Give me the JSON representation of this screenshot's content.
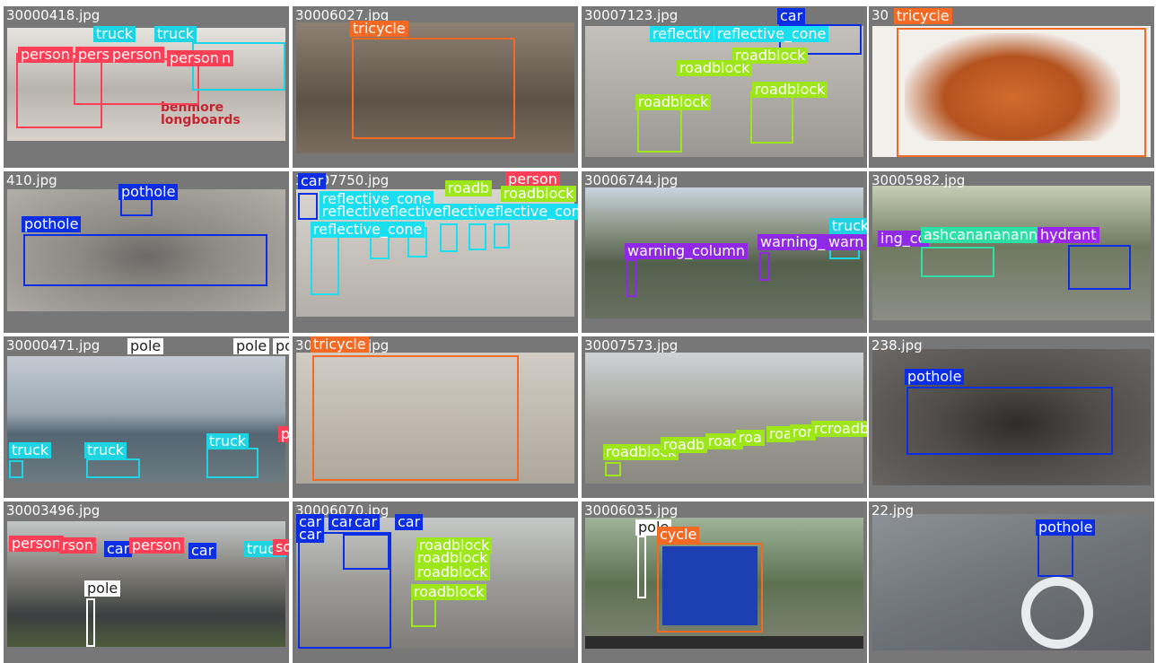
{
  "colors": {
    "person": "#ff3f55",
    "truck": "#1fd4e2",
    "tricycle": "#f46a25",
    "reflective_cone": "#19dff0",
    "roadblock": "#9ce619",
    "car": "#0b2de3",
    "pothole": "#0b2de3",
    "warning_column": "#8f29e6",
    "pole": "#ffffff",
    "hydrant": "#9b25e8",
    "trash_can": "#2ee0a6"
  },
  "tiles": [
    {
      "filename": "30000418.jpg",
      "photo_color": "#cfc8c0",
      "labels": [
        {
          "text": "truck",
          "cls": "truck"
        },
        {
          "text": "truck",
          "cls": "truck"
        },
        {
          "text": "person",
          "cls": "person"
        },
        {
          "text": "pers",
          "cls": "person"
        },
        {
          "text": "person",
          "cls": "person"
        },
        {
          "text": "person",
          "cls": "person"
        },
        {
          "text": "n",
          "cls": "person"
        },
        {
          "text": "benmore longboards",
          "cls": "logo"
        }
      ]
    },
    {
      "filename": "30006027.jpg",
      "photo_color": "#6b5d4e",
      "labels": [
        {
          "text": "tricycle",
          "cls": "tricycle"
        }
      ]
    },
    {
      "filename": "30007123.jpg",
      "photo_color": "#a3a09a",
      "labels": [
        {
          "text": "car",
          "cls": "car"
        },
        {
          "text": "reflective_cone",
          "cls": "reflective_cone"
        },
        {
          "text": "reflectiv",
          "cls": "reflective_cone"
        },
        {
          "text": "roadblock",
          "cls": "roadblock"
        },
        {
          "text": "roadblock",
          "cls": "roadblock"
        },
        {
          "text": "roadblock",
          "cls": "roadblock"
        },
        {
          "text": "roadblock",
          "cls": "roadblock"
        }
      ]
    },
    {
      "filename": "30007251.jpg",
      "filename_visible": "30",
      "photo_color": "#f2efec",
      "labels": [
        {
          "text": "tricycle",
          "cls": "tricycle"
        }
      ]
    },
    {
      "filename": "410.jpg",
      "photo_color": "#8f8c87",
      "labels": [
        {
          "text": "pothole",
          "cls": "pothole"
        },
        {
          "text": "pothole",
          "cls": "pothole"
        }
      ]
    },
    {
      "filename": "30007750.jpg",
      "photo_color": "#b9b5b0",
      "labels": [
        {
          "text": "car",
          "cls": "car"
        },
        {
          "text": "person",
          "cls": "person"
        },
        {
          "text": "reflective_cone",
          "cls": "reflective_cone"
        },
        {
          "text": "reflectiveflectiveflectiveflective_cone",
          "cls": "reflective_cone"
        },
        {
          "text": "reflective_cone",
          "cls": "reflective_cone"
        },
        {
          "text": "roadblock",
          "cls": "roadblock"
        },
        {
          "text": "roadb",
          "cls": "roadblock"
        },
        {
          "text": "ck",
          "cls": "roadblock"
        }
      ]
    },
    {
      "filename": "30006744.jpg",
      "photo_color": "#5f6a5a",
      "labels": [
        {
          "text": "warning_column",
          "cls": "warning_column"
        },
        {
          "text": "warning_",
          "cls": "warning_column"
        },
        {
          "text": "warn",
          "cls": "warning_column"
        },
        {
          "text": "truck",
          "cls": "truck"
        }
      ]
    },
    {
      "filename": "30005982.jpg",
      "photo_color": "#6f7a64",
      "labels": [
        {
          "text": "ing_co",
          "cls": "warning_column"
        },
        {
          "text": "ashcanananann",
          "cls": "trash_can"
        },
        {
          "text": "hydrant",
          "cls": "hydrant"
        }
      ]
    },
    {
      "filename": "30000471.jpg",
      "photo_color": "#8ea0ad",
      "labels": [
        {
          "text": "pole",
          "cls": "pole"
        },
        {
          "text": "pole",
          "cls": "pole"
        },
        {
          "text": "pole",
          "cls": "pole"
        },
        {
          "text": "truck",
          "cls": "truck"
        },
        {
          "text": "truck",
          "cls": "truck"
        },
        {
          "text": "truck",
          "cls": "truck"
        },
        {
          "text": "person",
          "cls": "person"
        }
      ]
    },
    {
      "filename": "30000381.jpg",
      "photo_color": "#bdb7ae",
      "labels": [
        {
          "text": "tricycle",
          "cls": "tricycle"
        }
      ]
    },
    {
      "filename": "30007573.jpg",
      "photo_color": "#9a9990",
      "labels": [
        {
          "text": "roadblock",
          "cls": "roadblock"
        },
        {
          "text": "roadb",
          "cls": "roadblock"
        },
        {
          "text": "road",
          "cls": "roadblock"
        },
        {
          "text": "roa",
          "cls": "roadblock"
        },
        {
          "text": "roa",
          "cls": "roadblock"
        },
        {
          "text": "ror",
          "cls": "roadblock"
        },
        {
          "text": "rcroadblock",
          "cls": "roadblock"
        }
      ]
    },
    {
      "filename": "238.jpg",
      "photo_color": "#4e4c4a",
      "labels": [
        {
          "text": "pothole",
          "cls": "pothole"
        }
      ]
    },
    {
      "filename": "30003496.jpg",
      "photo_color": "#8c8a86",
      "labels": [
        {
          "text": "person",
          "cls": "person"
        },
        {
          "text": "rson",
          "cls": "person"
        },
        {
          "text": "car",
          "cls": "car"
        },
        {
          "text": "person",
          "cls": "person"
        },
        {
          "text": "car",
          "cls": "car"
        },
        {
          "text": "truck",
          "cls": "truck"
        },
        {
          "text": "son",
          "cls": "person"
        },
        {
          "text": "pole",
          "cls": "pole"
        }
      ]
    },
    {
      "filename": "30006070.jpg",
      "photo_color": "#9d9b98",
      "labels": [
        {
          "text": "car",
          "cls": "car"
        },
        {
          "text": "car",
          "cls": "car"
        },
        {
          "text": "car",
          "cls": "car"
        },
        {
          "text": "car",
          "cls": "car"
        },
        {
          "text": "car",
          "cls": "car"
        },
        {
          "text": "roadblock",
          "cls": "roadblock"
        },
        {
          "text": "roadblock",
          "cls": "roadblock"
        },
        {
          "text": "roadblock",
          "cls": "roadblock"
        },
        {
          "text": "roadblock",
          "cls": "roadblock"
        }
      ]
    },
    {
      "filename": "30006035.jpg",
      "photo_color": "#6f7f62",
      "labels": [
        {
          "text": "pole",
          "cls": "pole"
        },
        {
          "text": "cycle",
          "cls": "tricycle"
        }
      ]
    },
    {
      "filename": "22.jpg",
      "photo_color": "#6f7378",
      "labels": [
        {
          "text": "pothole",
          "cls": "pothole"
        }
      ]
    }
  ]
}
